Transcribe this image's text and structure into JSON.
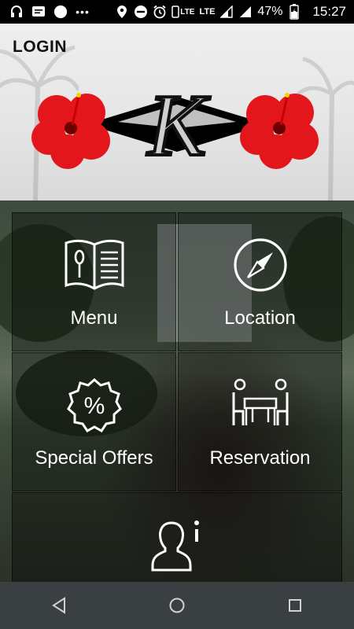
{
  "status_bar": {
    "network": "LTE",
    "network2": "LTE",
    "battery_percent": "47%",
    "time": "15:27",
    "icons": [
      "headset-icon",
      "message-icon",
      "circle-icon",
      "more-icon",
      "location-icon",
      "do-not-disturb-icon",
      "alarm-icon",
      "phone-lte-icon",
      "signal-icon",
      "signal-icon",
      "battery-icon"
    ]
  },
  "header": {
    "login_label": "LOGIN",
    "logo_letter": "K"
  },
  "tiles": [
    {
      "label": "Menu",
      "icon": "menu-book-icon"
    },
    {
      "label": "Location",
      "icon": "compass-icon"
    },
    {
      "label": "Special Offers",
      "icon": "percent-badge-icon"
    },
    {
      "label": "Reservation",
      "icon": "dining-table-icon"
    },
    {
      "label": "",
      "icon": "user-info-icon"
    }
  ],
  "nav": [
    "back-icon",
    "home-icon",
    "recents-icon"
  ],
  "colors": {
    "hibiscus": "#e3161c",
    "navbar": "#3a3f42",
    "statusbar": "#000000"
  }
}
